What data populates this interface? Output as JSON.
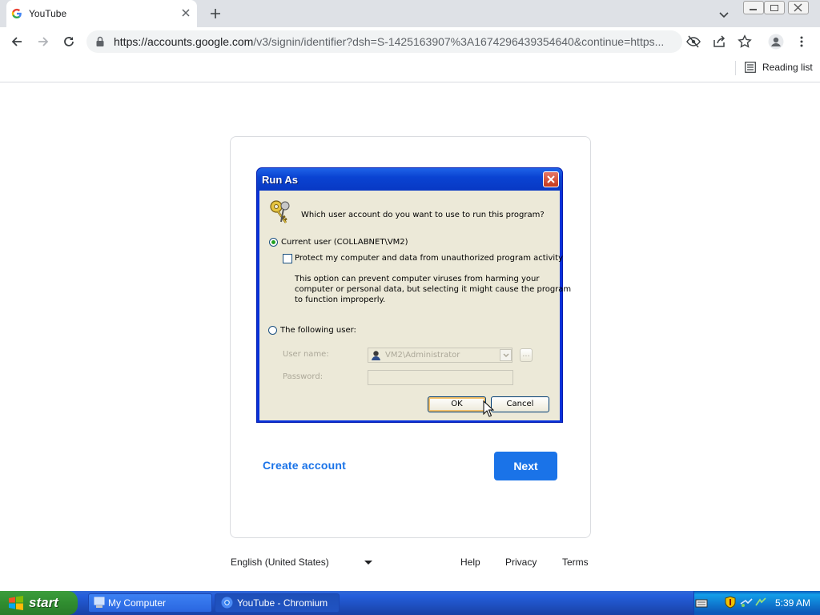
{
  "browser": {
    "tab": {
      "title": "YouTube"
    },
    "url": {
      "host": "https://accounts.google.com",
      "path": "/v3/signin/identifier?dsh=S-1425163907%3A1674296439354640&continue=https..."
    },
    "bookmarks": {
      "reading_list": "Reading list"
    }
  },
  "page": {
    "create_account": "Create account",
    "next": "Next",
    "language": "English (United States)",
    "footer": {
      "help": "Help",
      "privacy": "Privacy",
      "terms": "Terms"
    }
  },
  "dialog": {
    "title": "Run As",
    "question": "Which user account do you want to use to run this program?",
    "current_user": "Current user (COLLABNET\\VM2)",
    "protect": "Protect my computer and data from unauthorized program activity",
    "info_lines": [
      "This option can prevent computer viruses from harming your",
      "computer or personal data, but selecting it might cause the program",
      "to function improperly."
    ],
    "following_user": "The following user:",
    "username_label": "User name:",
    "username_value": "VM2\\Administrator",
    "password_label": "Password:",
    "browse": "...",
    "ok": "OK",
    "cancel": "Cancel"
  },
  "taskbar": {
    "start": "start",
    "items": [
      "My Computer",
      "YouTube - Chromium"
    ],
    "clock": "5:39 AM"
  }
}
